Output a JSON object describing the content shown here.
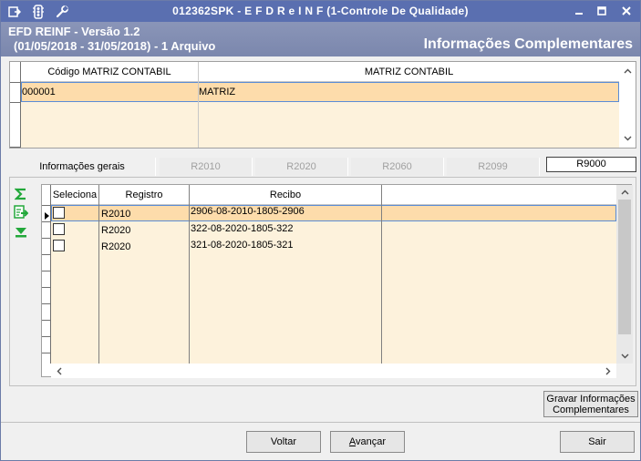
{
  "titlebar": {
    "title": "012362SPK - E F D  R e I N F (1-Controle De Qualidade)",
    "icons": [
      "menu-icon",
      "traffic-light-icon",
      "wrench-icon"
    ],
    "controls": [
      "minimize-icon",
      "maximize-icon",
      "close-icon"
    ]
  },
  "header": {
    "line1": "EFD REINF - Versão 1.2",
    "line2": "(01/05/2018 - 31/05/2018) - 1 Arquivo",
    "section_title": "Informações Complementares"
  },
  "matriz_grid": {
    "columns": [
      "Código MATRIZ CONTABIL",
      "MATRIZ CONTABIL"
    ],
    "rows": [
      {
        "codigo": "000001",
        "matriz": "MATRIZ"
      }
    ]
  },
  "tabs": [
    {
      "label": "Informações gerais",
      "state": "normal"
    },
    {
      "label": "R2010",
      "state": "disabled"
    },
    {
      "label": "R2020",
      "state": "disabled"
    },
    {
      "label": "R2060",
      "state": "disabled"
    },
    {
      "label": "R2099",
      "state": "disabled"
    },
    {
      "label": "R9000",
      "state": "active"
    }
  ],
  "recibo_grid": {
    "columns": [
      "Seleciona",
      "Registro",
      "Recibo"
    ],
    "rows": [
      {
        "registro": "R2010",
        "recibo": "2906-08-2010-1805-2906",
        "selected": true
      },
      {
        "registro": "R2020",
        "recibo": "322-08-2020-1805-322",
        "selected": false
      },
      {
        "registro": "R2020",
        "recibo": "321-08-2020-1805-321",
        "selected": false
      }
    ]
  },
  "side_buttons": [
    "sum-icon",
    "export-icon",
    "download-icon"
  ],
  "buttons": {
    "gravar_line1": "Gravar Informações",
    "gravar_line2": "Complementares",
    "voltar": "Voltar",
    "avancar_u": "A",
    "avancar_rest": "vançar",
    "sair": "Sair"
  },
  "colors": {
    "titlebar": "#5a6fb0",
    "header": "#7b87ad",
    "selected_row": "#fddcab",
    "grid_body": "#fdf2dc",
    "green_icon": "#22a83a"
  }
}
